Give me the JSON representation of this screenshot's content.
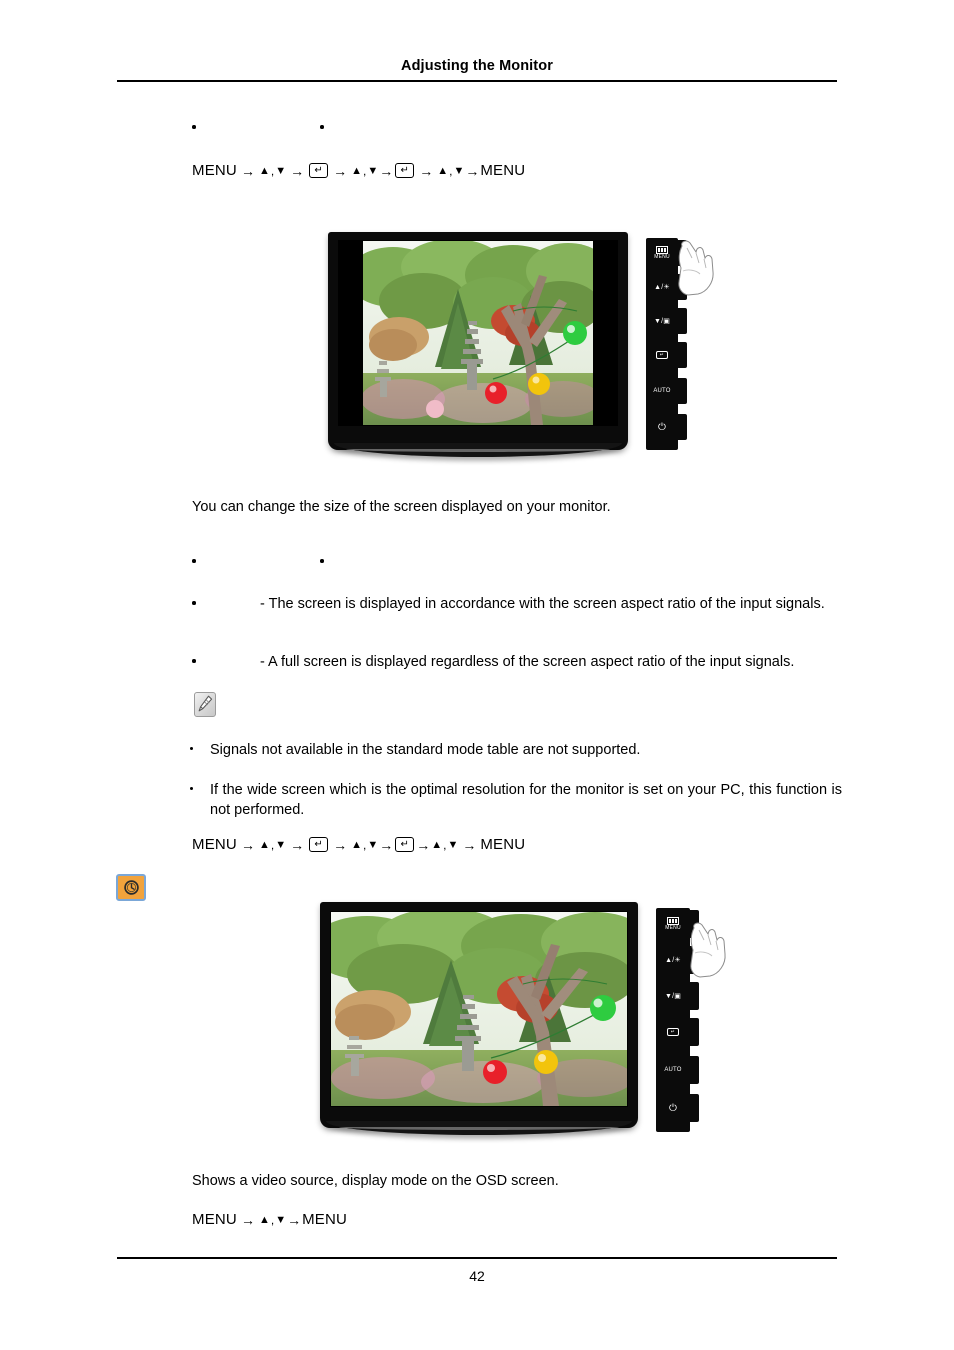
{
  "document": {
    "header_title": "Adjusting the Monitor",
    "page_number": "42"
  },
  "section_top": {
    "breadcrumb_bullets": [
      {
        "dot": "•",
        "label": ""
      },
      {
        "dot": "•",
        "label": ""
      }
    ],
    "menu_sequence": {
      "start": "MENU",
      "end": "MENU",
      "arrow": "→",
      "up": "▲",
      "down": "▼",
      "comma": ",",
      "enter_key": "↵",
      "full_text": "MENU → ▲ , ▼ → ↵ → ▲ , ▼ → ↵ → ▲ , ▼ → MENU"
    }
  },
  "figure_top": {
    "caption": "",
    "alt": "Monitor displaying a garden photo in 4:3 aspect ratio with black side bars; a hand points at the MENU button",
    "buttons": [
      {
        "id": "menu",
        "label": "MENU",
        "glyph": "menu-bars"
      },
      {
        "id": "up-brightness",
        "label": "",
        "glyph": "▲/☀"
      },
      {
        "id": "down-source",
        "label": "",
        "glyph": "▼/▣"
      },
      {
        "id": "enter",
        "label": "",
        "glyph": "↵"
      },
      {
        "id": "auto",
        "label": "AUTO",
        "glyph": ""
      },
      {
        "id": "power",
        "label": "",
        "glyph": "⏻"
      }
    ]
  },
  "body_paragraph_1": "You can change the size of the screen displayed on your monitor.",
  "section_mid": {
    "breadcrumb_bullets": [
      {
        "dot": "•",
        "label": ""
      },
      {
        "dot": "•",
        "label": ""
      }
    ],
    "options": [
      {
        "name": "",
        "description": "- The screen is displayed in accordance with the screen aspect ratio of the input signals."
      },
      {
        "name": "",
        "description": "- A full screen is displayed regardless of the screen aspect ratio of the input signals."
      }
    ]
  },
  "note": {
    "icon": "note-pencil-icon",
    "items": [
      "Signals not available in the standard mode table are not supported.",
      "If the wide screen which is the optimal resolution for the monitor is set on your PC, this function is not performed."
    ],
    "menu_sequence": {
      "start": "MENU",
      "end": "MENU",
      "arrow": "→",
      "up": "▲",
      "down": "▼",
      "comma": ",",
      "enter_key": "↵",
      "full_text": "MENU → ▲ , ▼ → ↵ → ▲ , ▼ → ↵ → ▲ , ▼ → MENU"
    }
  },
  "badge": {
    "icon": "clock-badge-icon",
    "label": "",
    "fill_color": "#f2a33c",
    "border_color": "#7ba7d7"
  },
  "figure_bottom": {
    "caption": "",
    "alt": "Monitor displaying a garden photo filling the full screen; a hand points at the MENU button",
    "buttons": [
      {
        "id": "menu",
        "label": "MENU",
        "glyph": "menu-bars"
      },
      {
        "id": "up-brightness",
        "label": "",
        "glyph": "▲/☀"
      },
      {
        "id": "down-source",
        "label": "",
        "glyph": "▼/▣"
      },
      {
        "id": "enter",
        "label": "",
        "glyph": "↵"
      },
      {
        "id": "auto",
        "label": "AUTO",
        "glyph": ""
      },
      {
        "id": "power",
        "label": "",
        "glyph": "⏻"
      }
    ]
  },
  "body_paragraph_2": "Shows a video source, display mode on the OSD screen.",
  "final_menu_sequence": {
    "start": "MENU",
    "end": "MENU",
    "arrow": "→",
    "up": "▲",
    "down": "▼",
    "comma": ",",
    "full_text": "MENU → ▲ , ▼ → MENU"
  }
}
